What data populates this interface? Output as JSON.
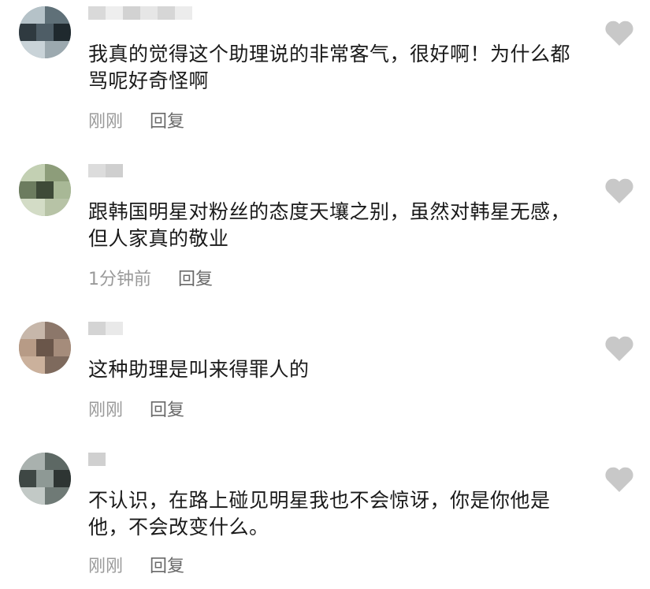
{
  "colors": {
    "text": "#1a1a1a",
    "meta_time": "#9a9a9a",
    "reply": "#6a6a6a",
    "heart": "#c8c8c8"
  },
  "icons": {
    "like": "heart-icon"
  },
  "comments": [
    {
      "text": "我真的觉得这个助理说的非常客气，很好啊！为什么都骂呢好奇怪啊",
      "time": "刚刚",
      "reply": "回复"
    },
    {
      "text": "跟韩国明星对粉丝的态度天壤之别，虽然对韩星无感，但人家真的敬业",
      "time": "1分钟前",
      "reply": "回复"
    },
    {
      "text": "这种助理是叫来得罪人的",
      "time": "刚刚",
      "reply": "回复"
    },
    {
      "text": "不认识，在路上碰见明星我也不会惊讶，你是你他是他，不会改变什么。",
      "time": "刚刚",
      "reply": "回复"
    }
  ]
}
